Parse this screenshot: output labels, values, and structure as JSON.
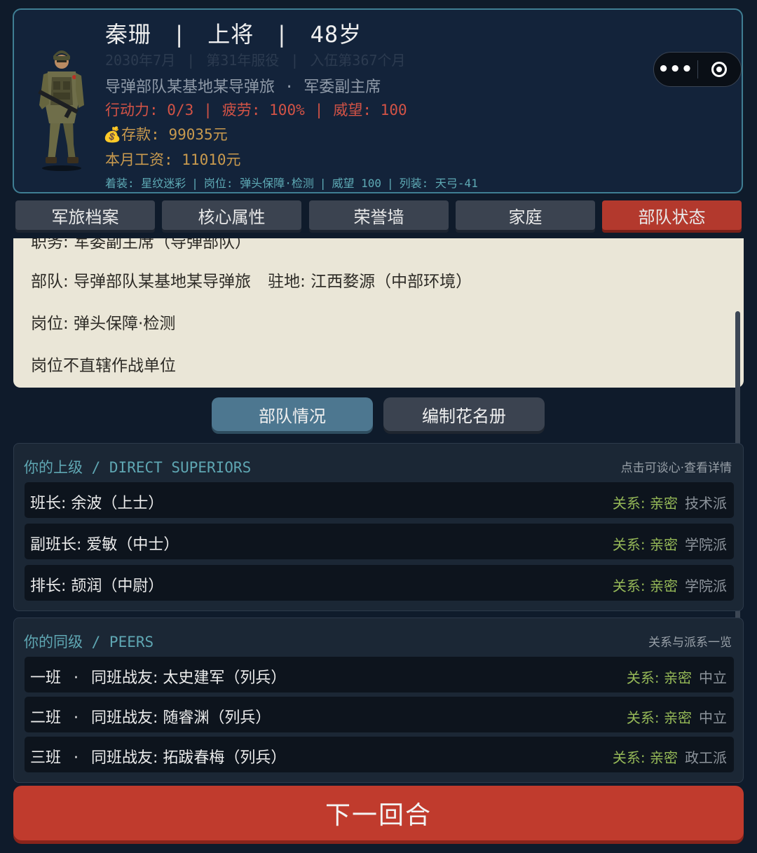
{
  "header": {
    "name": "秦珊",
    "rank": "上将",
    "age": "48岁",
    "faded": {
      "date": "2030年7月",
      "service": "第31年服役",
      "enlisted": "入伍第367个月"
    },
    "unit": "导弹部队某基地某导弹旅",
    "position": "军委副主席",
    "status": {
      "action": "行动力: 0/3",
      "fatigue": "疲劳: 100%",
      "prestige": "威望: 100"
    },
    "money_icon": "moneybag-icon",
    "savings": "存款: 99035元",
    "salary": "本月工资: 11010元",
    "info": {
      "uniform": "着装: 星纹迷彩",
      "post": "岗位: 弹头保障·检测",
      "prestige": "威望 100",
      "equip": "列装: 天弓-41"
    }
  },
  "tabs": [
    {
      "label": "军旅档案"
    },
    {
      "label": "核心属性"
    },
    {
      "label": "荣誉墙"
    },
    {
      "label": "家庭"
    },
    {
      "label": "部队状态"
    }
  ],
  "detail": {
    "cut_line": "职务: 军委副主席（导弹部队）",
    "unit_label": "部队: 导弹部队某基地某导弹旅",
    "station": "驻地: 江西婺源（中部环境）",
    "post": "岗位: 弹头保障·检测",
    "note": "岗位不直辖作战单位"
  },
  "subtabs": [
    {
      "label": "部队情况"
    },
    {
      "label": "编制花名册"
    }
  ],
  "superiors": {
    "title": "你的上级 / DIRECT SUPERIORS",
    "hint": "点击可谈心·查看详情",
    "rows": [
      {
        "who": "班长: 余波（上士）",
        "rel": "关系: 亲密",
        "faction": "技术派"
      },
      {
        "who": "副班长: 爱敏（中士）",
        "rel": "关系: 亲密",
        "faction": "学院派"
      },
      {
        "who": "排长: 颉润（中尉）",
        "rel": "关系: 亲密",
        "faction": "学院派"
      }
    ]
  },
  "peers": {
    "title": "你的同级 / PEERS",
    "hint": "关系与派系一览",
    "rows": [
      {
        "squad": "一班",
        "who": "同班战友: 太史建军（列兵）",
        "rel": "关系: 亲密",
        "faction": "中立"
      },
      {
        "squad": "二班",
        "who": "同班战友: 随睿渊（列兵）",
        "rel": "关系: 亲密",
        "faction": "中立"
      },
      {
        "squad": "三班",
        "who": "同班战友: 拓跋春梅（列兵）",
        "rel": "关系: 亲密",
        "faction": "政工派"
      }
    ]
  },
  "next_turn": "下一回合",
  "colors": {
    "background": "#0f1b2b",
    "accent_red": "#c03b2d",
    "teal": "#5fa7b3",
    "relation_green": "#95b857",
    "gold": "#c99a4e"
  }
}
